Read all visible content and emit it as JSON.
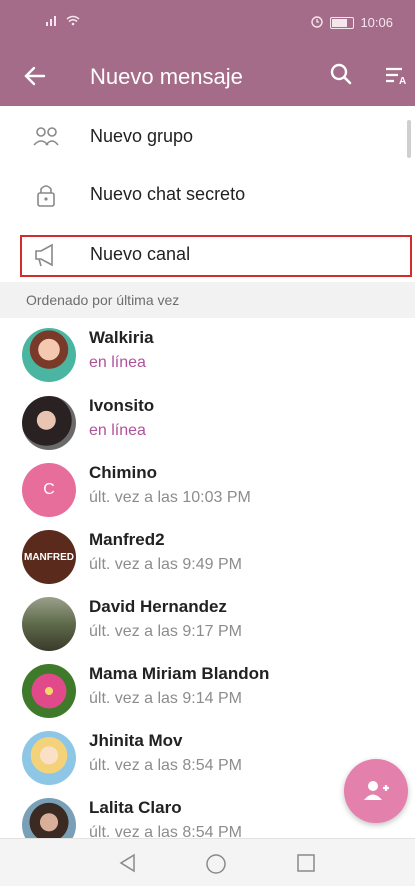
{
  "status_bar": {
    "time": "10:06"
  },
  "app_bar": {
    "title": "Nuevo mensaje"
  },
  "menu": {
    "new_group": "Nuevo grupo",
    "new_secret_chat": "Nuevo chat secreto",
    "new_channel": "Nuevo canal"
  },
  "section_header": "Ordenado por última vez",
  "contacts": [
    {
      "name": "Walkiria",
      "status": "en línea",
      "online": true
    },
    {
      "name": "Ivonsito",
      "status": "en línea",
      "online": true
    },
    {
      "name": "Chimino",
      "status": "últ. vez a las 10:03 PM",
      "avatar_letter": "C"
    },
    {
      "name": "Manfred2",
      "status": "últ. vez a las 9:49 PM",
      "avatar_text": "MANFRED"
    },
    {
      "name": "David Hernandez",
      "status": "últ. vez a las 9:17 PM"
    },
    {
      "name": "Mama Miriam Blandon",
      "status": "últ. vez a las 9:14 PM"
    },
    {
      "name": "Jhinita Mov",
      "status": "últ. vez a las 8:54 PM"
    },
    {
      "name": "Lalita Claro",
      "status": "últ. vez a las 8:54 PM"
    }
  ],
  "colors": {
    "app_bar": "#a56c8a",
    "online": "#b0529b",
    "fab": "#e381ac",
    "highlight_border": "#d42c2c"
  }
}
